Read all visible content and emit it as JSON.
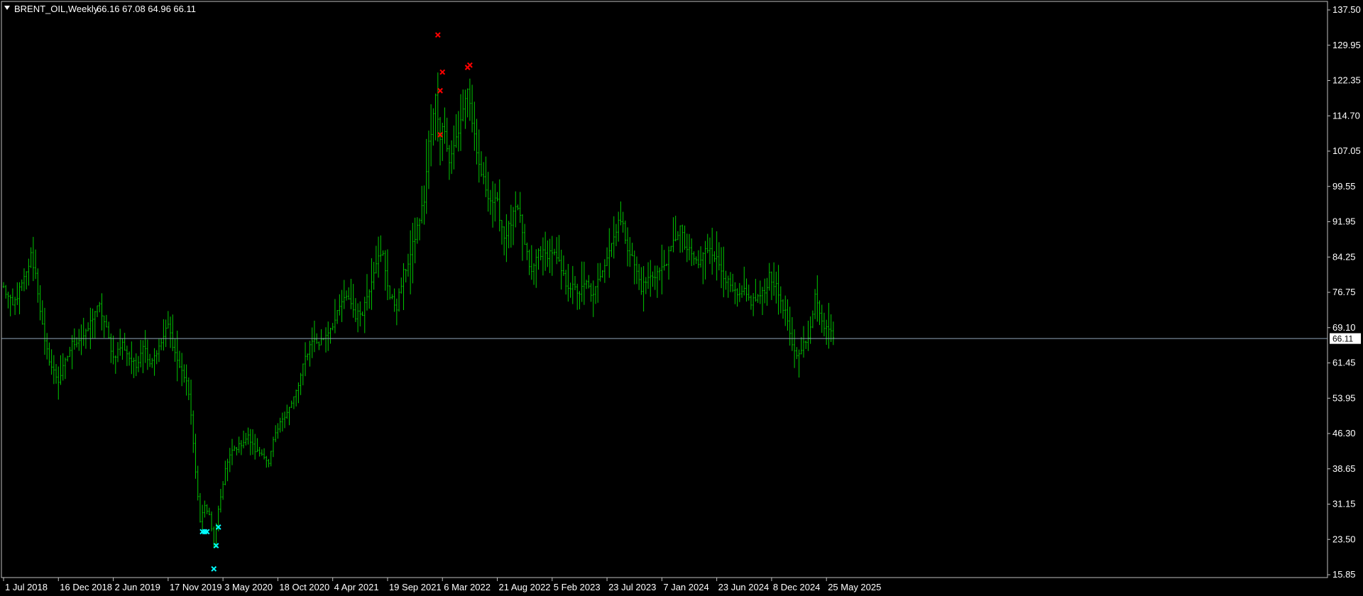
{
  "header": {
    "symbol": "BRENT_OIL,Weekly",
    "ohlc": "66.16 67.08 64.96 66.11"
  },
  "colors": {
    "background": "#000000",
    "frame": "#c0c0c0",
    "bars": "#00c800",
    "high_marker": "#ff0000",
    "low_marker": "#00ffff",
    "price_line": "#8fa3b8",
    "text": "#ffffff"
  },
  "chart_data": {
    "type": "ohlc-bar",
    "symbol": "BRENT_OIL",
    "timeframe": "Weekly",
    "last_price_label": "66.11",
    "ylim": [
      15.85,
      137.5
    ],
    "y_ticks": [
      "137.50",
      "129.95",
      "122.35",
      "114.70",
      "107.05",
      "99.55",
      "91.95",
      "84.25",
      "76.75",
      "69.10",
      "61.45",
      "53.95",
      "46.30",
      "38.65",
      "31.15",
      "23.50",
      "15.85"
    ],
    "x_ticks": [
      "1 Jul 2018",
      "16 Dec 2018",
      "2 Jun 2019",
      "17 Nov 2019",
      "3 May 2020",
      "18 Oct 2020",
      "4 Apr 2021",
      "19 Sep 2021",
      "6 Mar 2022",
      "21 Aug 2022",
      "5 Feb 2023",
      "23 Jul 2023",
      "7 Jan 2024",
      "23 Jun 2024",
      "8 Dec 2024",
      "25 May 2025"
    ],
    "x_tick_week_index": [
      0,
      24,
      48,
      72,
      96,
      120,
      144,
      168,
      192,
      216,
      240,
      264,
      288,
      312,
      336,
      360
    ],
    "total_weeks": 372,
    "series": [
      {
        "name": "BRENT_OIL,Weekly",
        "anchors": [
          [
            0,
            77
          ],
          [
            4,
            73
          ],
          [
            10,
            80
          ],
          [
            12,
            84
          ],
          [
            14,
            80
          ],
          [
            18,
            65
          ],
          [
            21,
            60
          ],
          [
            24,
            57
          ],
          [
            27,
            61
          ],
          [
            30,
            65
          ],
          [
            33,
            66
          ],
          [
            36,
            67
          ],
          [
            40,
            72
          ],
          [
            42,
            73
          ],
          [
            45,
            68
          ],
          [
            48,
            62
          ],
          [
            52,
            65
          ],
          [
            55,
            62
          ],
          [
            58,
            60
          ],
          [
            61,
            65
          ],
          [
            64,
            61
          ],
          [
            68,
            64
          ],
          [
            72,
            69
          ],
          [
            75,
            63
          ],
          [
            77,
            60
          ],
          [
            80,
            57
          ],
          [
            82,
            50
          ],
          [
            84,
            37
          ],
          [
            86,
            27
          ],
          [
            88,
            30
          ],
          [
            90,
            28
          ],
          [
            92,
            22
          ],
          [
            94,
            29
          ],
          [
            97,
            38
          ],
          [
            100,
            42
          ],
          [
            103,
            43
          ],
          [
            107,
            45
          ],
          [
            110,
            42
          ],
          [
            114,
            41
          ],
          [
            116,
            39
          ],
          [
            118,
            44
          ],
          [
            122,
            49
          ],
          [
            126,
            52
          ],
          [
            129,
            56
          ],
          [
            132,
            62
          ],
          [
            135,
            66
          ],
          [
            138,
            65
          ],
          [
            141,
            67
          ],
          [
            145,
            70
          ],
          [
            148,
            74
          ],
          [
            151,
            75
          ],
          [
            154,
            71
          ],
          [
            157,
            72
          ],
          [
            160,
            77
          ],
          [
            163,
            83
          ],
          [
            166,
            84
          ],
          [
            169,
            75
          ],
          [
            172,
            73
          ],
          [
            175,
            80
          ],
          [
            178,
            84
          ],
          [
            181,
            90
          ],
          [
            184,
            96
          ],
          [
            186,
            108
          ],
          [
            187,
            110
          ],
          [
            189,
            118
          ],
          [
            191,
            110
          ],
          [
            193,
            112
          ],
          [
            195,
            104
          ],
          [
            197,
            108
          ],
          [
            199,
            110
          ],
          [
            201,
            116
          ],
          [
            203,
            120
          ],
          [
            205,
            113
          ],
          [
            207,
            105
          ],
          [
            210,
            100
          ],
          [
            213,
            96
          ],
          [
            216,
            95
          ],
          [
            219,
            88
          ],
          [
            222,
            91
          ],
          [
            224,
            94
          ],
          [
            226,
            92
          ],
          [
            228,
            86
          ],
          [
            231,
            80
          ],
          [
            234,
            85
          ],
          [
            237,
            84
          ],
          [
            240,
            85
          ],
          [
            243,
            82
          ],
          [
            246,
            78
          ],
          [
            249,
            77
          ],
          [
            252,
            76
          ],
          [
            255,
            78
          ],
          [
            258,
            75
          ],
          [
            261,
            80
          ],
          [
            264,
            84
          ],
          [
            267,
            88
          ],
          [
            269,
            92
          ],
          [
            271,
            90
          ],
          [
            273,
            86
          ],
          [
            276,
            82
          ],
          [
            279,
            77
          ],
          [
            282,
            79
          ],
          [
            285,
            80
          ],
          [
            288,
            81
          ],
          [
            291,
            84
          ],
          [
            294,
            88
          ],
          [
            296,
            90
          ],
          [
            298,
            86
          ],
          [
            301,
            84
          ],
          [
            304,
            82
          ],
          [
            307,
            85
          ],
          [
            309,
            86
          ],
          [
            312,
            83
          ],
          [
            315,
            80
          ],
          [
            318,
            77
          ],
          [
            321,
            75
          ],
          [
            324,
            76
          ],
          [
            327,
            74
          ],
          [
            330,
            75
          ],
          [
            333,
            76
          ],
          [
            335,
            80
          ],
          [
            338,
            77
          ],
          [
            341,
            73
          ],
          [
            343,
            70
          ],
          [
            345,
            64
          ],
          [
            347,
            62
          ],
          [
            349,
            64
          ],
          [
            351,
            66
          ],
          [
            353,
            68
          ],
          [
            355,
            75
          ],
          [
            357,
            72
          ],
          [
            359,
            69
          ],
          [
            361,
            68
          ],
          [
            363,
            67
          ]
        ],
        "high_markers": [
          [
            190,
            131.5
          ],
          [
            191,
            119.5
          ],
          [
            191,
            110.0
          ],
          [
            192,
            123.5
          ],
          [
            203,
            124.5
          ],
          [
            204,
            125.0
          ]
        ],
        "low_markers": [
          [
            87,
            24.5
          ],
          [
            88,
            24.5
          ],
          [
            89,
            24.5
          ],
          [
            92,
            16.5
          ],
          [
            93,
            21.5
          ],
          [
            94,
            25.5
          ]
        ]
      }
    ]
  }
}
